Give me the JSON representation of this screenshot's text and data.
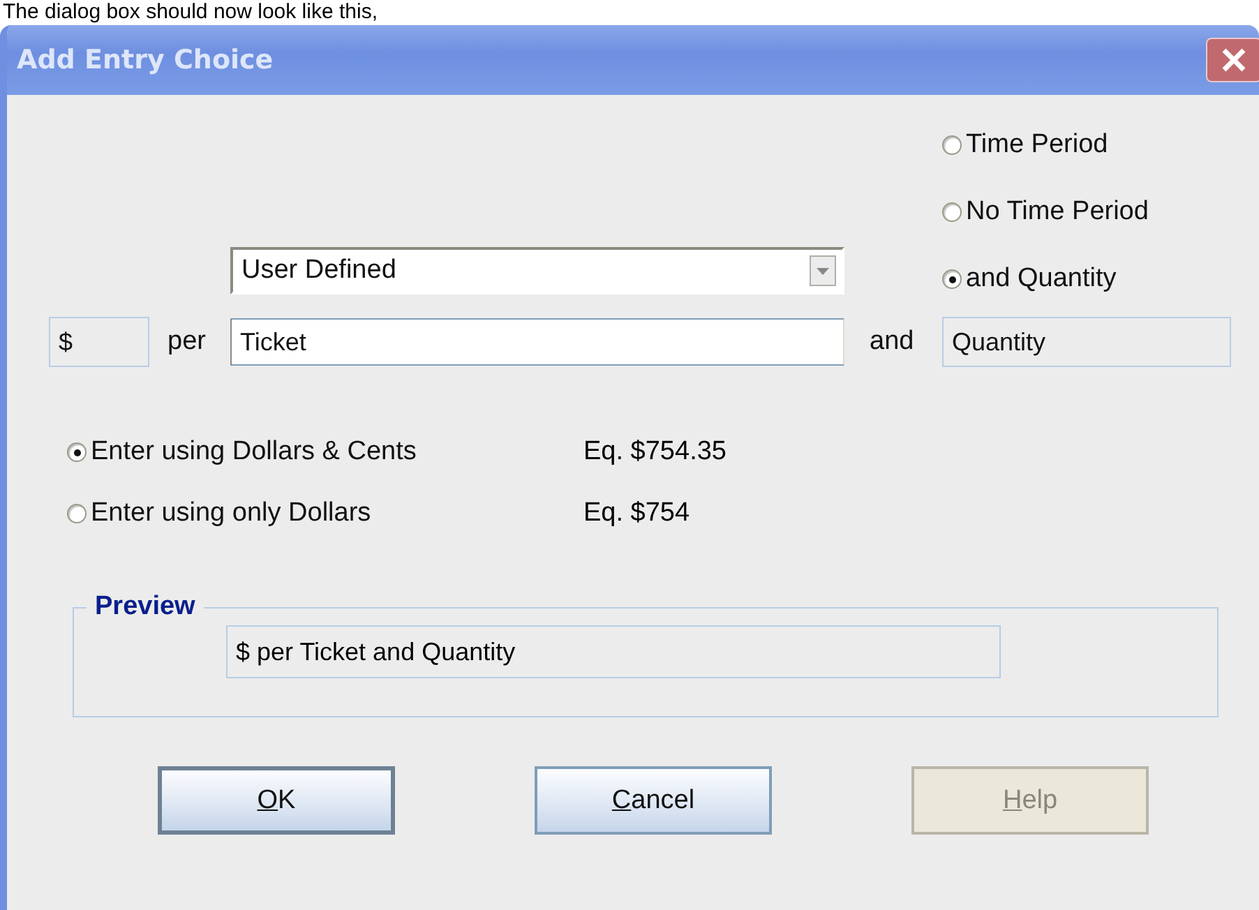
{
  "caption": "The dialog box should now look like this,",
  "window": {
    "title": "Add Entry Choice"
  },
  "period_options": [
    {
      "label": "Time Period",
      "selected": false
    },
    {
      "label": "No Time Period",
      "selected": false
    },
    {
      "label": "and Quantity",
      "selected": true
    }
  ],
  "type_dropdown": {
    "value": "User Defined"
  },
  "unit_row": {
    "currency": "$",
    "per_label": "per",
    "unit": "Ticket",
    "and_label": "and",
    "quantity": "Quantity"
  },
  "entry_options": [
    {
      "label": "Enter using Dollars & Cents",
      "example": "Eq. $754.35",
      "selected": true
    },
    {
      "label": "Enter using only Dollars",
      "example": "Eq. $754",
      "selected": false
    }
  ],
  "preview": {
    "title": "Preview",
    "value": "$ per Ticket and Quantity"
  },
  "buttons": [
    {
      "label": "OK",
      "disabled": false,
      "default": true
    },
    {
      "label": "Cancel",
      "disabled": false,
      "default": false
    },
    {
      "label": "Help",
      "disabled": true,
      "default": false
    }
  ]
}
